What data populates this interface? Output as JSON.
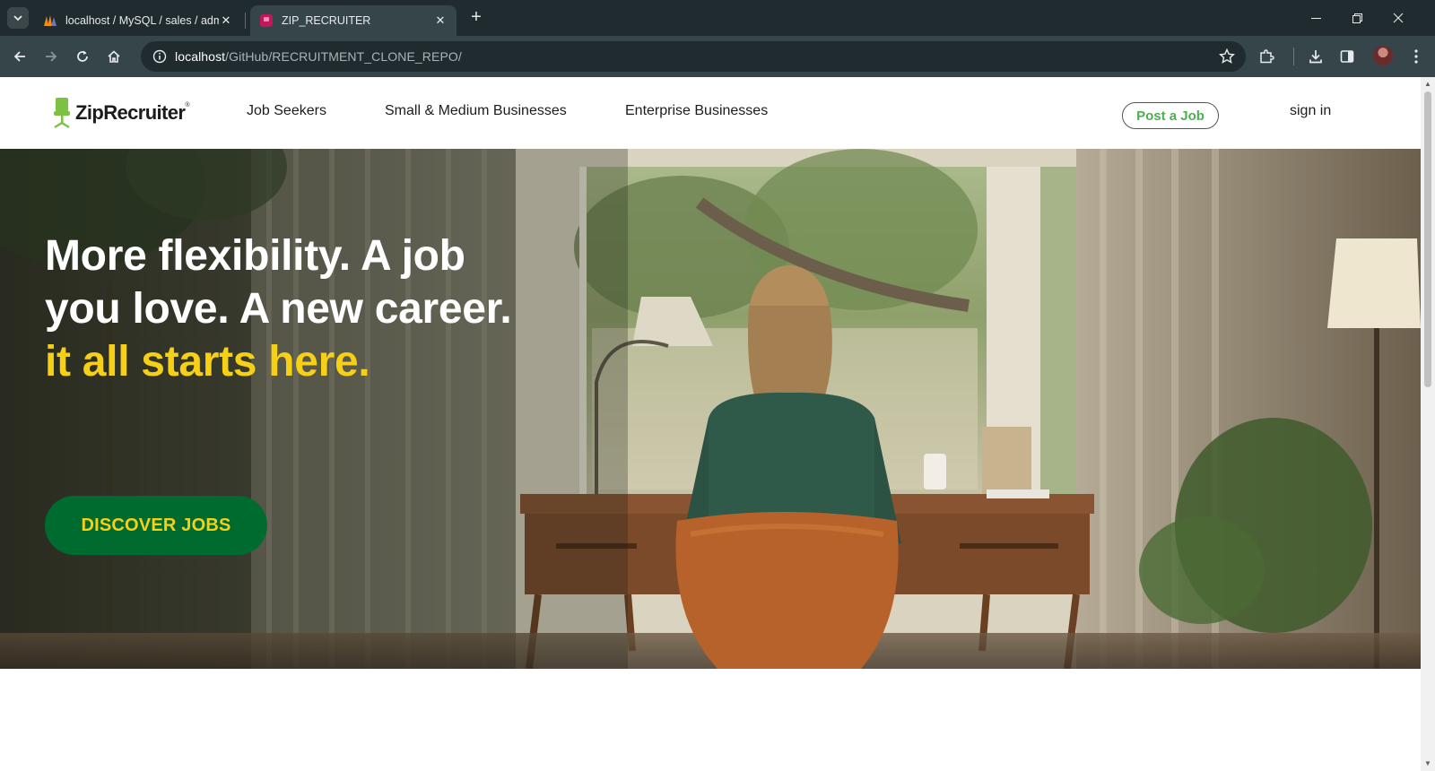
{
  "browser": {
    "tabs": [
      {
        "title": "localhost / MySQL / sales / adm",
        "favicon": "phpmyadmin-icon",
        "active": false
      },
      {
        "title": "ZIP_RECRUITER",
        "favicon": "zip-recruiter-favicon",
        "active": true
      }
    ],
    "url_host": "localhost",
    "url_path": "/GitHub/RECRUITMENT_CLONE_REPO/"
  },
  "nav": {
    "logo_text": "ZipRecruiter",
    "logo_tm": "®",
    "links": [
      "Job Seekers",
      "Small & Medium Businesses",
      "Enterprise Businesses"
    ],
    "post_job": "Post a Job",
    "sign_in": "sign in"
  },
  "hero": {
    "title_white": "More flexibility. A job you love. A new career.",
    "title_accent": "it all starts here.",
    "cta": "DISCOVER JOBS"
  },
  "colors": {
    "brand_green": "#006b2f",
    "accent_yellow": "#f6cf17",
    "post_job_green": "#4caf50",
    "logo_green": "#7cc242"
  }
}
